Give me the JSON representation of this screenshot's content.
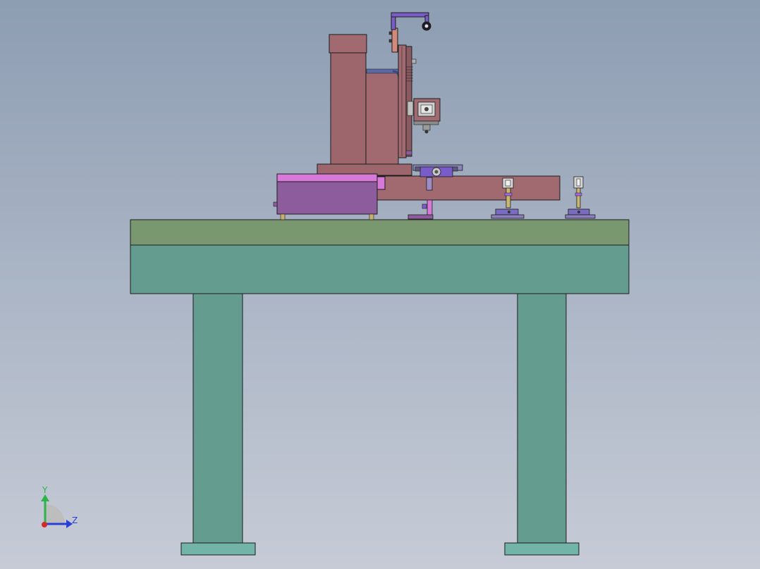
{
  "view": {
    "background_top": "#8d9db2",
    "background_bottom": "#c6cbd6"
  },
  "triad": {
    "y_label": "Y",
    "z_label": "Z",
    "y_color": "#2db34a",
    "z_color": "#2a3fd6",
    "x_color": "#d62a2a"
  },
  "colors": {
    "table_top": "#7a9870",
    "table_apron": "#649c90",
    "table_foot": "#72b5a8",
    "machine_body": "#a06a70",
    "enclosure": "#8c5c9c",
    "enclosure_highlight": "#d878d8",
    "accent_purple": "#7a5cc8",
    "outline": "#1c1c1c"
  }
}
